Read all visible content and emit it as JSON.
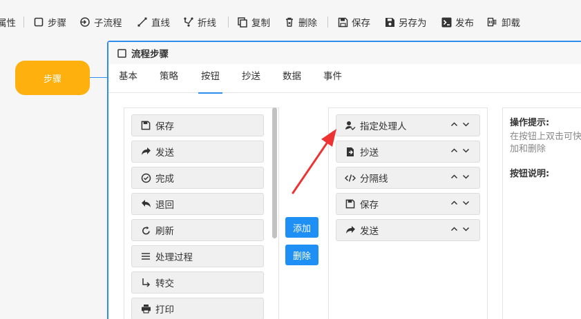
{
  "toolbar": {
    "items": [
      {
        "label": "属性",
        "icon": "none"
      },
      {
        "label": "步骤",
        "icon": "square-icon"
      },
      {
        "label": "子流程",
        "icon": "subflow-icon"
      },
      {
        "label": "直线",
        "icon": "line-icon"
      },
      {
        "label": "折线",
        "icon": "polyline-icon"
      },
      {
        "label": "复制",
        "icon": "copy-icon"
      },
      {
        "label": "删除",
        "icon": "trash-icon"
      },
      {
        "label": "保存",
        "icon": "save-icon"
      },
      {
        "label": "另存为",
        "icon": "save-as-icon"
      },
      {
        "label": "发布",
        "icon": "publish-icon"
      },
      {
        "label": "卸载",
        "icon": "uninstall-icon"
      }
    ]
  },
  "canvas": {
    "node_label": "步骤",
    "node_color": "#fdb00e"
  },
  "dialog": {
    "title": "流程步骤",
    "tabs": [
      "基本",
      "策略",
      "按钮",
      "抄送",
      "数据",
      "事件"
    ],
    "active_tab": "按钮",
    "accent": "#2d8cf0"
  },
  "available_buttons": [
    {
      "label": "保存",
      "icon": "save-icon"
    },
    {
      "label": "发送",
      "icon": "share-arrow-icon"
    },
    {
      "label": "完成",
      "icon": "check-circle-icon"
    },
    {
      "label": "退回",
      "icon": "reply-icon"
    },
    {
      "label": "刷新",
      "icon": "refresh-icon"
    },
    {
      "label": "处理过程",
      "icon": "list-icon"
    },
    {
      "label": "转交",
      "icon": "turn-arrow-icon"
    },
    {
      "label": "打印",
      "icon": "print-icon"
    }
  ],
  "actions": {
    "add": "添加",
    "remove": "删除",
    "color": "#1e8ff5"
  },
  "selected_buttons": [
    {
      "label": "指定处理人",
      "icon": "user-check-icon"
    },
    {
      "label": "抄送",
      "icon": "cc-icon"
    },
    {
      "label": "分隔线",
      "icon": "code-icon"
    },
    {
      "label": "保存",
      "icon": "save-icon"
    },
    {
      "label": "发送",
      "icon": "share-arrow-icon"
    }
  ],
  "tips": {
    "title": "操作提示:",
    "line1": "在按钮上双击可快",
    "line2": "加和删除",
    "desc_title": "按钮说明:"
  },
  "annotation_arrow_color": "#ee3333"
}
